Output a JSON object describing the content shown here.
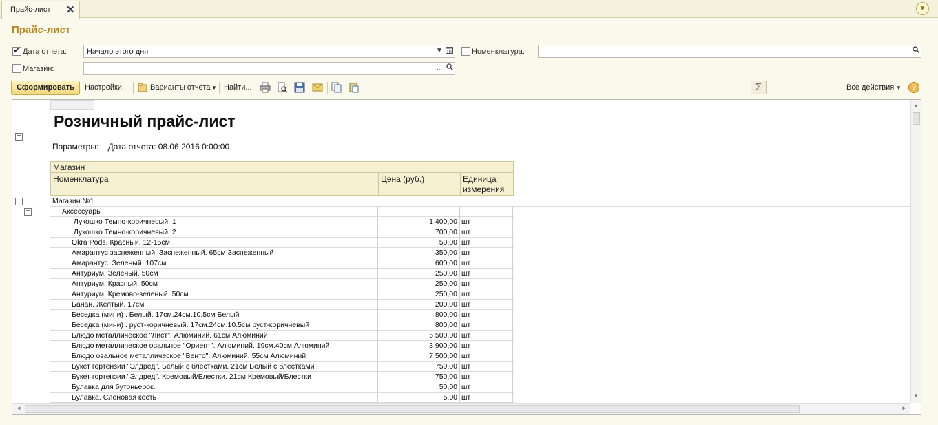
{
  "tab": {
    "label": "Прайс-лист",
    "close": "✕"
  },
  "page_title": "Прайс-лист",
  "filters": {
    "date": {
      "label": "Дата отчета:",
      "value": "Начало этого дня",
      "checked": true
    },
    "nomenclature": {
      "label": "Номенклатура:",
      "value": "",
      "checked": false
    },
    "store": {
      "label": "Магазин:",
      "value": "",
      "checked": false
    },
    "ellipsis": "..."
  },
  "toolbar": {
    "generate": "Сформировать",
    "settings": "Настройки...",
    "variants": "Варианты отчета",
    "find": "Найти...",
    "all_actions": "Все действия",
    "sigma": "Σ",
    "help": "?"
  },
  "report": {
    "title": "Розничный прайс-лист",
    "params_label": "Параметры:",
    "params_value": "Дата отчета: 08.06.2016 0:00:00",
    "headers": {
      "store": "Магазин",
      "nomenclature": "Номенклатура",
      "price": "Цена (руб.)",
      "unit": "Единица измерения"
    },
    "group_store": "Магазин №1",
    "group_category": "Аксессуары",
    "rows": [
      {
        "name": "Лукошко Темно-коричневый. 1",
        "price": "1 400,00",
        "unit": "шт"
      },
      {
        "name": "Лукошко Темно-коричневый. 2",
        "price": "700,00",
        "unit": "шт"
      },
      {
        "name": "Okra Pods. Красный. 12-15см",
        "price": "50,00",
        "unit": "шт"
      },
      {
        "name": "Амарантус заснеженный. Заснеженный. 65см Заснеженный",
        "price": "350,00",
        "unit": "шт"
      },
      {
        "name": "Амарантус. Зеленый. 107см",
        "price": "600,00",
        "unit": "шт"
      },
      {
        "name": "Антуриум. Зеленый. 50см",
        "price": "250,00",
        "unit": "шт"
      },
      {
        "name": "Антуриум. Красный. 50см",
        "price": "250,00",
        "unit": "шт"
      },
      {
        "name": "Антуриум. Кремово-зеленый. 50см",
        "price": "250,00",
        "unit": "шт"
      },
      {
        "name": "Банан. Желтый. 17см",
        "price": "200,00",
        "unit": "шт"
      },
      {
        "name": "Беседка (мини) . Белый. 17см.24см.10.5см Белый",
        "price": "800,00",
        "unit": "шт"
      },
      {
        "name": "Беседка (мини) . руст-коричневый. 17см.24см.10.5см руст-коричневый",
        "price": "800,00",
        "unit": "шт"
      },
      {
        "name": "Блюдо металлическое \"Лист\". Алюминий. 61см Алюминий",
        "price": "5 500,00",
        "unit": "шт"
      },
      {
        "name": "Блюдо металлическое овальное \"Ориент\". Алюминий. 19см.40см Алюминий",
        "price": "3 900,00",
        "unit": "шт"
      },
      {
        "name": "Блюдо овальное металлическое \"Венто\". Алюминий. 55см Алюминий",
        "price": "7 500,00",
        "unit": "шт"
      },
      {
        "name": "Букет гортензии \"Элдред\". Белый с блестками. 21см Белый с блестками",
        "price": "750,00",
        "unit": "шт"
      },
      {
        "name": "Букет гортензии \"Элдред\". Кремовый/Блестки. 21см Кремовый/Блестки",
        "price": "750,00",
        "unit": "шт"
      },
      {
        "name": "Булавка для бутоньерок.",
        "price": "50,00",
        "unit": "шт"
      },
      {
        "name": "Булавка. Слоновая кость",
        "price": "5,00",
        "unit": "шт"
      }
    ]
  }
}
